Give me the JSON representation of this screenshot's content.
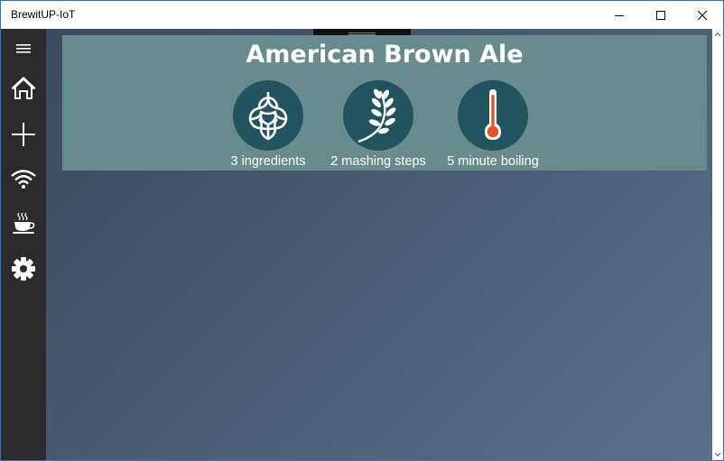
{
  "window": {
    "title": "BrewitUP-IoT",
    "controls": [
      "minimize-icon",
      "maximize-icon",
      "close-icon"
    ]
  },
  "sidebar": {
    "items": [
      {
        "name": "menu",
        "icon": "hamburger-menu-icon"
      },
      {
        "name": "home",
        "icon": "home-icon"
      },
      {
        "name": "add",
        "icon": "plus-icon"
      },
      {
        "name": "connect",
        "icon": "wifi-icon"
      },
      {
        "name": "brew",
        "icon": "coffee-cup-icon"
      },
      {
        "name": "settings",
        "icon": "gear-icon"
      }
    ]
  },
  "recipe": {
    "name": "American Brown Ale",
    "features": [
      {
        "icon": "hop-icon",
        "label": "3 ingredients"
      },
      {
        "icon": "wheat-icon",
        "label": "2 mashing steps"
      },
      {
        "icon": "thermometer-icon",
        "label": "5 minute boiling"
      }
    ]
  },
  "colors": {
    "sidebar": "#2b2b2b",
    "panel": "#688b8d",
    "icon_circle": "#22545f",
    "thermometer_bulb": "#e8541e"
  }
}
